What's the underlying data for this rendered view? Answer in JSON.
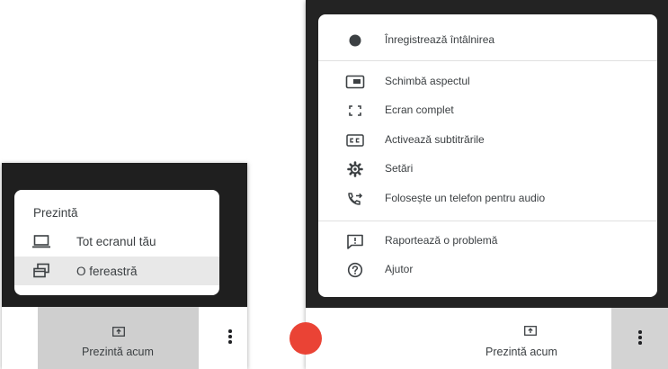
{
  "left": {
    "present_menu": {
      "title": "Prezintă",
      "items": [
        {
          "label": "Tot ecranul tău",
          "icon": "laptop-icon",
          "selected": false
        },
        {
          "label": "O fereastră",
          "icon": "window-icon",
          "selected": true
        }
      ]
    },
    "bottom_bar": {
      "present_label": "Prezintă acum",
      "present_icon": "present-screen-icon",
      "more_icon": "more-vert-icon"
    }
  },
  "right": {
    "options_menu": {
      "items": [
        {
          "label": "Înregistrează întâlnirea",
          "icon": "record-icon"
        },
        {
          "label": "Schimbă aspectul",
          "icon": "layout-icon"
        },
        {
          "label": "Ecran complet",
          "icon": "fullscreen-icon"
        },
        {
          "label": "Activează subtitrările",
          "icon": "captions-icon"
        },
        {
          "label": "Setări",
          "icon": "gear-icon"
        },
        {
          "label": "Folosește un telefon pentru audio",
          "icon": "phone-forward-icon"
        },
        {
          "label": "Raportează o problemă",
          "icon": "feedback-icon"
        },
        {
          "label": "Ajutor",
          "icon": "help-icon"
        }
      ]
    },
    "bottom_bar": {
      "present_label": "Prezintă acum",
      "present_icon": "present-screen-icon",
      "more_icon": "more-vert-icon"
    }
  },
  "colors": {
    "dark_background": "#232323",
    "menu_background": "#ffffff",
    "selected_item": "#e8e8e8",
    "present_button_bg": "#cfcfcf",
    "end_call_red": "#ea4335",
    "text": "#3c4043"
  }
}
